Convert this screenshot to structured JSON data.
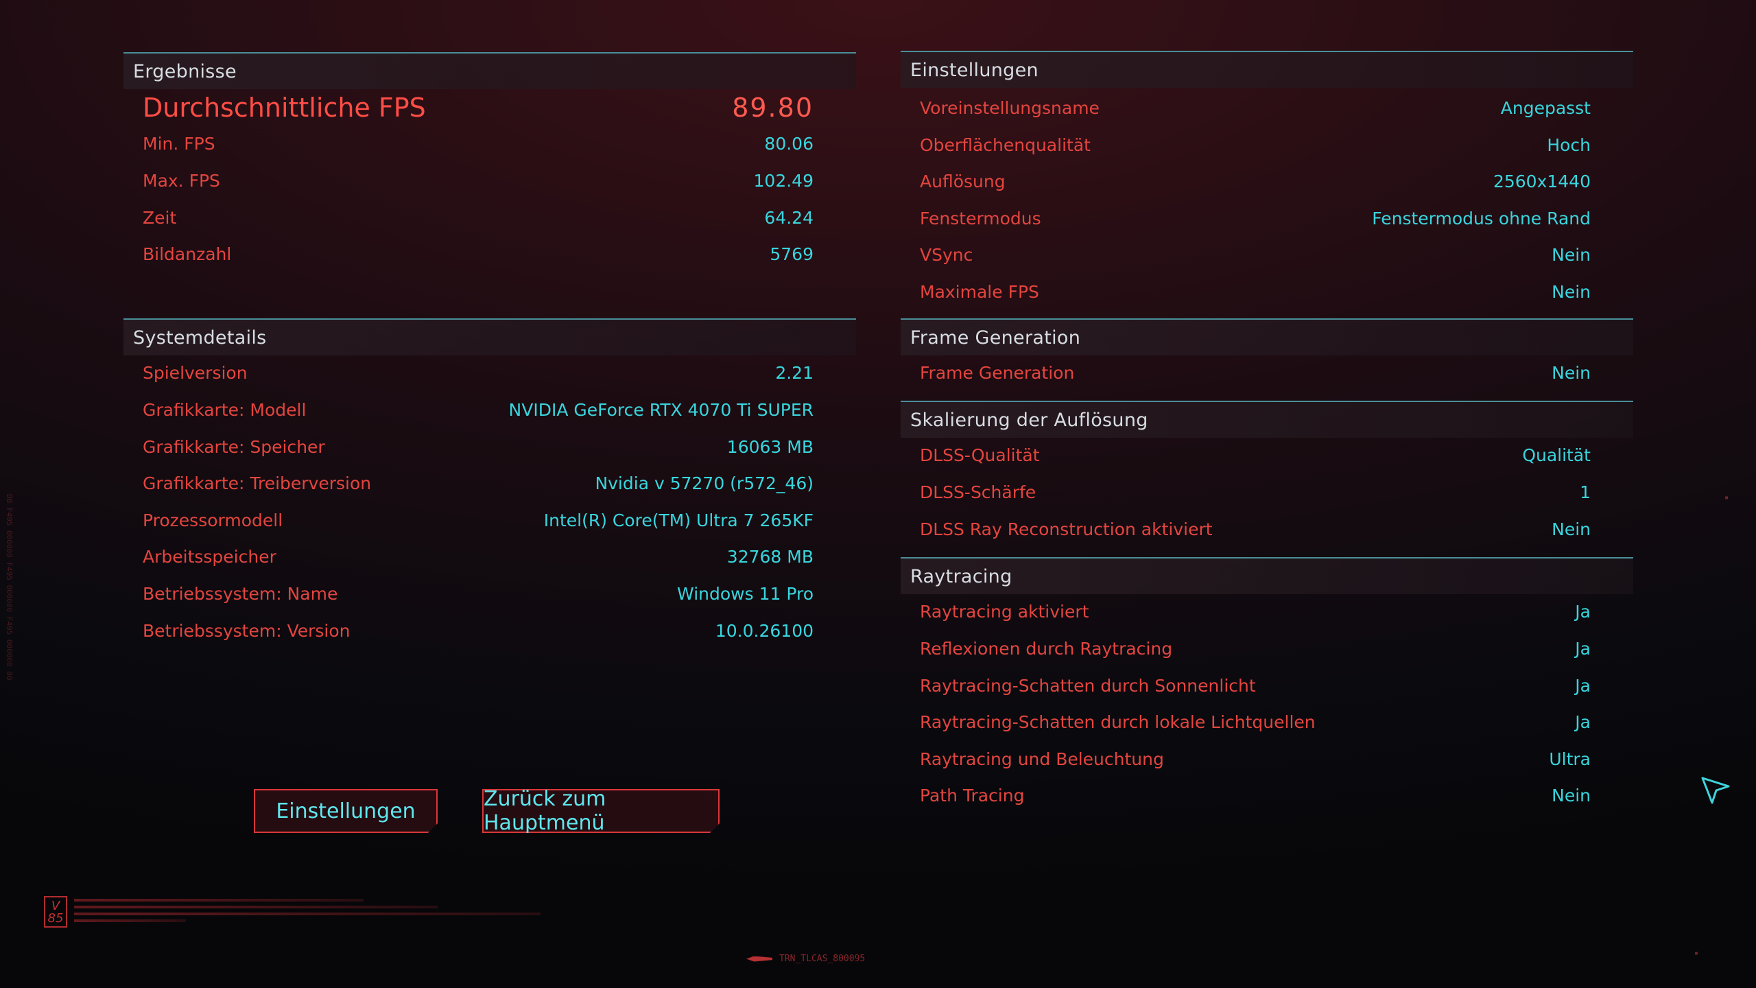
{
  "results": {
    "title": "Ergebnisse",
    "rows": [
      {
        "label": "Durchschnittliche FPS",
        "value": "89.80"
      },
      {
        "label": "Min. FPS",
        "value": "80.06"
      },
      {
        "label": "Max. FPS",
        "value": "102.49"
      },
      {
        "label": "Zeit",
        "value": "64.24"
      },
      {
        "label": "Bildanzahl",
        "value": "5769"
      }
    ]
  },
  "system": {
    "title": "Systemdetails",
    "rows": [
      {
        "label": "Spielversion",
        "value": "2.21"
      },
      {
        "label": "Grafikkarte: Modell",
        "value": "NVIDIA GeForce RTX 4070 Ti SUPER"
      },
      {
        "label": "Grafikkarte: Speicher",
        "value": "16063 MB"
      },
      {
        "label": "Grafikkarte: Treiberversion",
        "value": "Nvidia v 57270 (r572_46)"
      },
      {
        "label": "Prozessormodell",
        "value": "Intel(R) Core(TM) Ultra 7 265KF"
      },
      {
        "label": "Arbeitsspeicher",
        "value": "32768 MB"
      },
      {
        "label": "Betriebssystem: Name",
        "value": "Windows 11 Pro"
      },
      {
        "label": "Betriebssystem: Version",
        "value": "10.0.26100"
      }
    ]
  },
  "settings": {
    "title": "Einstellungen",
    "rows": [
      {
        "label": "Voreinstellungsname",
        "value": "Angepasst"
      },
      {
        "label": "Oberflächenqualität",
        "value": "Hoch"
      },
      {
        "label": "Auflösung",
        "value": "2560x1440"
      },
      {
        "label": "Fenstermodus",
        "value": "Fenstermodus ohne Rand"
      },
      {
        "label": "VSync",
        "value": "Nein"
      },
      {
        "label": "Maximale FPS",
        "value": "Nein"
      }
    ]
  },
  "frame_gen": {
    "title": "Frame Generation",
    "rows": [
      {
        "label": "Frame Generation",
        "value": "Nein"
      }
    ]
  },
  "scaling": {
    "title": "Skalierung der Auflösung",
    "rows": [
      {
        "label": "DLSS-Qualität",
        "value": "Qualität"
      },
      {
        "label": "DLSS-Schärfe",
        "value": "1"
      },
      {
        "label": "DLSS Ray Reconstruction aktiviert",
        "value": "Nein"
      }
    ]
  },
  "raytracing": {
    "title": "Raytracing",
    "rows": [
      {
        "label": "Raytracing aktiviert",
        "value": "Ja"
      },
      {
        "label": "Reflexionen durch Raytracing",
        "value": "Ja"
      },
      {
        "label": "Raytracing-Schatten durch Sonnenlicht",
        "value": "Ja"
      },
      {
        "label": "Raytracing-Schatten durch lokale Lichtquellen",
        "value": "Ja"
      },
      {
        "label": "Raytracing und Beleuchtung",
        "value": "Ultra"
      },
      {
        "label": "Path Tracing",
        "value": "Nein"
      }
    ]
  },
  "buttons": {
    "settings": "Einstellungen",
    "main_menu": "Zurück zum Hauptmenü"
  },
  "footer": {
    "logo": "V 85",
    "code": "TRN_TLCAS_800095"
  },
  "icons": {
    "cursor": "cursor-arrow-icon"
  },
  "colors": {
    "label": "#e3453f",
    "value": "#39d5dd",
    "section_line": "#4a8f99"
  }
}
